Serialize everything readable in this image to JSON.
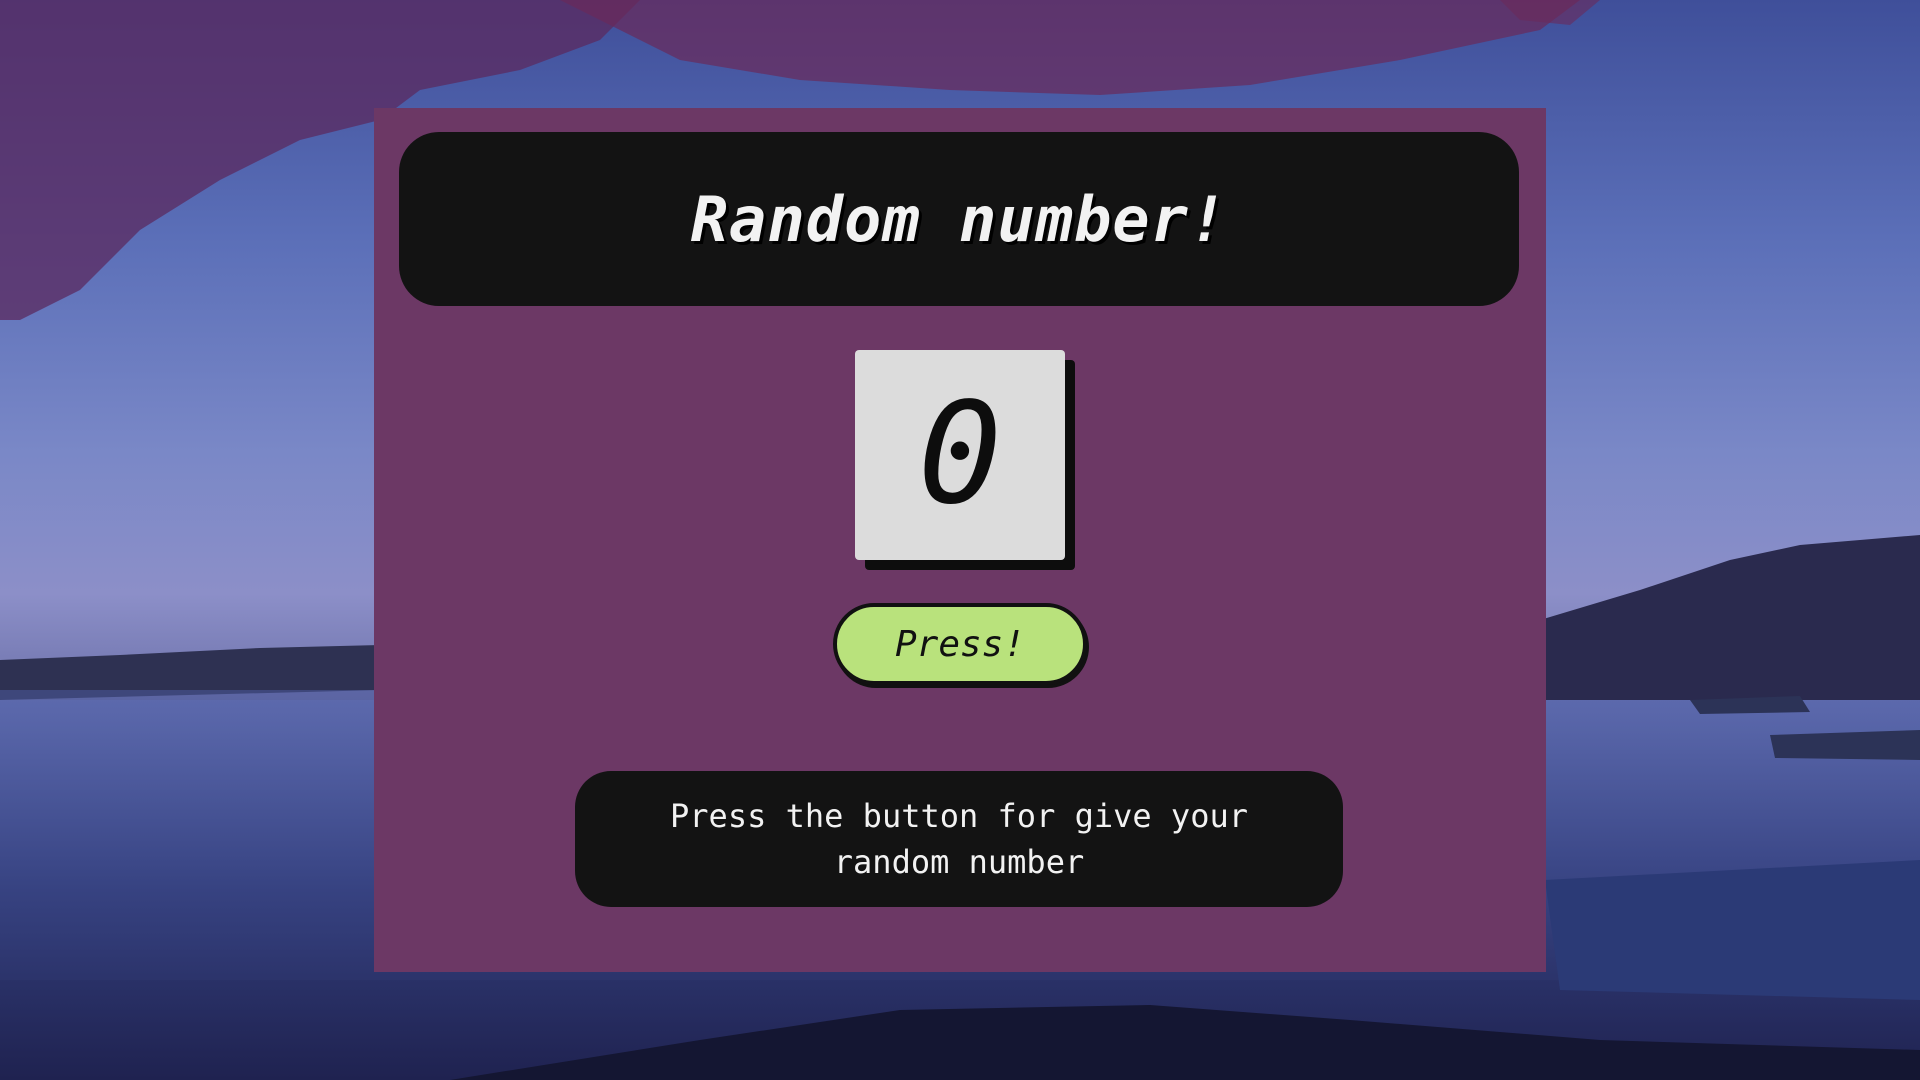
{
  "app": {
    "title": "Random number!",
    "number_value": "0",
    "button_label": "Press!",
    "hint": "Press the button for give your random number"
  },
  "colors": {
    "card_background": "#6c3865",
    "panel_dark": "#131313",
    "number_box": "#dcdcdc",
    "button_green": "#b9e27c",
    "text_light": "#f2f2f2"
  }
}
